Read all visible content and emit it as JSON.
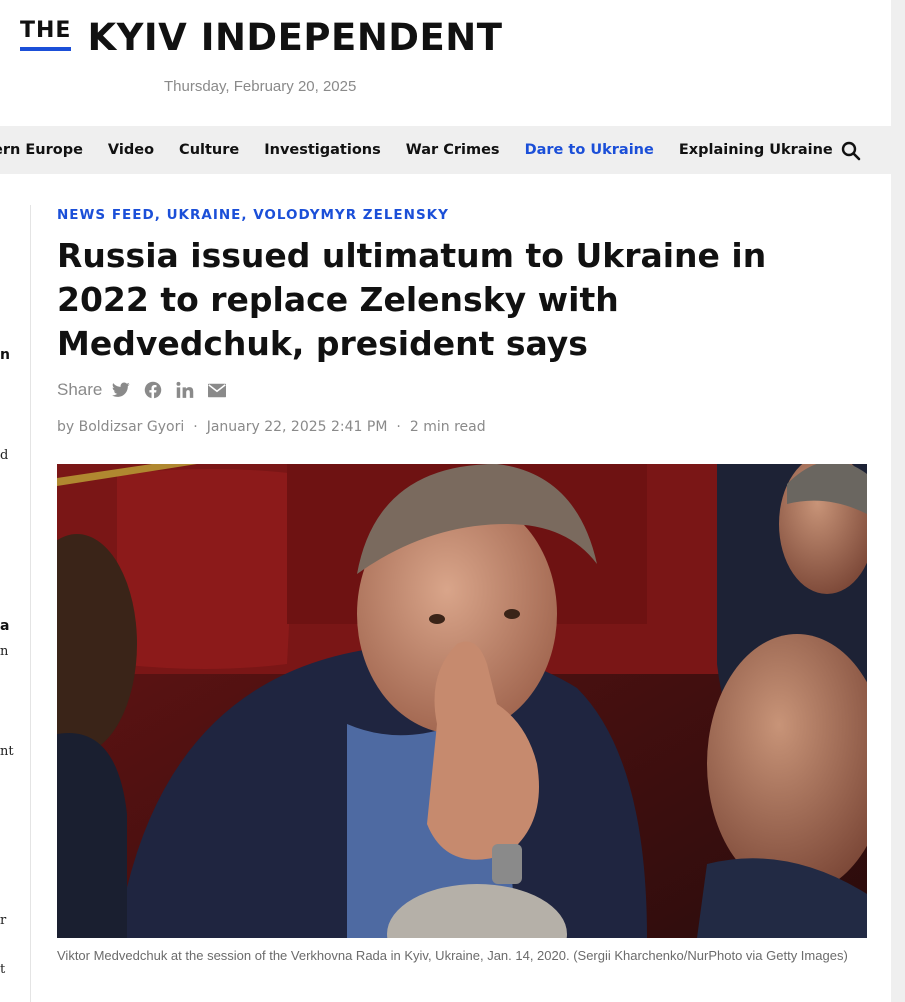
{
  "masthead": {
    "logo_the": "THE",
    "logo_name": "KYIV INDEPENDENT",
    "date": "Thursday, February 20, 2025"
  },
  "nav": {
    "items": [
      {
        "label": "ern Europe",
        "active": false
      },
      {
        "label": "Video",
        "active": false
      },
      {
        "label": "Culture",
        "active": false
      },
      {
        "label": "Investigations",
        "active": false
      },
      {
        "label": "War Crimes",
        "active": false
      },
      {
        "label": "Dare to Ukraine",
        "active": true
      },
      {
        "label": "Explaining Ukraine",
        "active": false
      }
    ],
    "search_icon": "search-icon",
    "accent_color": "#1b4fd8"
  },
  "sidebar_fragments": [
    "n",
    "d",
    "a",
    "n",
    "nt",
    "r",
    "t"
  ],
  "article": {
    "tags": [
      "NEWS FEED",
      "UKRAINE",
      "VOLODYMYR ZELENSKY"
    ],
    "title": "Russia issued ultimatum to Ukraine in 2022 to replace Zelensky with Medvedchuk, president says",
    "share_label": "Share",
    "share_icons": [
      "twitter-icon",
      "facebook-icon",
      "linkedin-icon",
      "email-icon"
    ],
    "author": "by Boldizsar Gyori",
    "published": "January 22, 2025 2:41 PM",
    "read_time": "2 min read",
    "caption": "Viktor Medvedchuk at the session of the Verkhovna Rada in Kyiv, Ukraine, Jan. 14, 2020. (Sergii Kharchenko/NurPhoto via Getty Images)"
  }
}
